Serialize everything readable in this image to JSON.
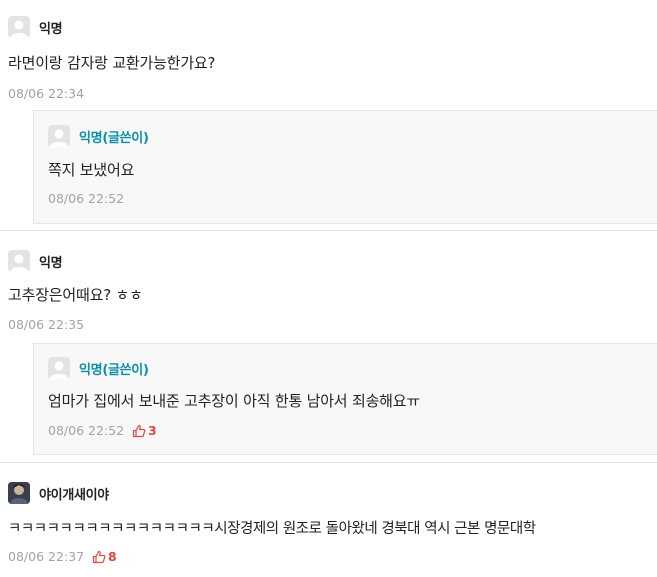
{
  "comments": [
    {
      "author": "익명",
      "text": "라면이랑 감자랑 교환가능한가요?",
      "time": "08/06 22:34",
      "reply": {
        "author": "익명(글쓴이)",
        "text": "쪽지 보냈어요",
        "time": "08/06 22:52"
      }
    },
    {
      "author": "익명",
      "text": "고추장은어때요? ㅎㅎ",
      "time": "08/06 22:35",
      "reply": {
        "author": "익명(글쓴이)",
        "text": "엄마가 집에서 보내준 고추장이 아직 한통 남아서 죄송해요ㅠ",
        "time": "08/06 22:52",
        "votes": "3"
      }
    },
    {
      "author": "야이개새이야",
      "text": "ㅋㅋㅋㅋㅋㅋㅋㅋㅋㅋㅋㅋㅋㅋㅋㅋ시장경제의 원조로 돌아왔네 경북대 역시 근본 명문대학",
      "time": "08/06 22:37",
      "votes": "8"
    }
  ],
  "icons": {
    "avatar": "default-avatar-icon",
    "vote": "thumbs-up-icon"
  },
  "colors": {
    "writer": "#0b8fa8",
    "vote": "#e0473e",
    "meta": "#a3a3a3",
    "reply_bg": "#f8f8f8"
  }
}
